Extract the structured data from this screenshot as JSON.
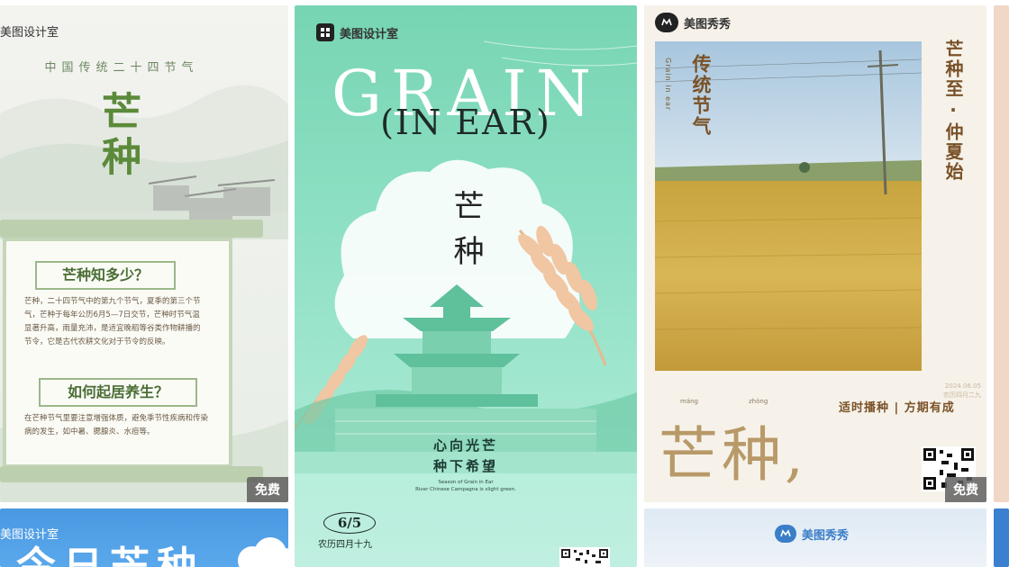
{
  "cards": [
    {
      "brand": "美图设计室",
      "top_line": "中国传统二十四节气",
      "title": "芒种",
      "section1_title": "芒种知多少？",
      "section1_text": "芒种，二十四节气中的第九个节气，夏季的第三个节气，芒种于每年公历6月5—7日交节，芒种时节气温显著升高，雨量充沛，是适宜晚稻等谷类作物耕播的节令，它是古代农耕文化对于节令的反映。",
      "section2_title": "如何起居养生？",
      "section2_text": "在芒种节气里要注意增强体质，避免季节性疾病和传染病的发生，如中暑、腮腺炎、水痘等。",
      "badge": "免费"
    },
    {
      "brand": "美图设计室",
      "headline": "GRAIN",
      "subhead": "(IN EAR)",
      "title": "芒种",
      "slogan_line1": "心向光芒",
      "slogan_line2": "种下希望",
      "en_line1": "Season of Grain in Ear",
      "en_line2": "River Chinese Campagna is slight green.",
      "date": "6/5",
      "lunar_date": "农历四月十九"
    },
    {
      "brand": "美图秀秀",
      "en_vertical": "Grain in ear",
      "vertical_left": "传统节气",
      "vertical_right": "芒种至·仲夏始",
      "date_small": "2024.06.05",
      "lunar_small": "农历四月二九",
      "pinyin_left": "máng",
      "pinyin_right": "zhòng",
      "slogan": "适时播种 | 方期有成",
      "big_title": "芒种,",
      "badge": "免费"
    },
    {
      "brand": "美图设计室",
      "big_partial": "今日芒种"
    },
    {
      "brand": "美图秀秀"
    }
  ],
  "colors": {
    "green_dark": "#5b8a3a",
    "mint": "#8ee0c4",
    "gold": "#caa24a",
    "tan_text": "#8a6a3e"
  }
}
